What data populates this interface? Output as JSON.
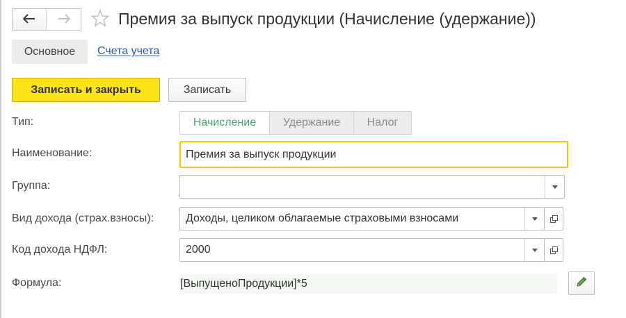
{
  "nav": {
    "back_icon": "arrow-left-icon",
    "forward_icon": "arrow-right-icon",
    "favorite_icon": "star-outline-icon"
  },
  "window": {
    "title": "Премия за выпуск продукции (Начисление (удержание))"
  },
  "tabs": [
    {
      "label": "Основное",
      "active": true
    },
    {
      "label": "Счета учета",
      "active": false
    }
  ],
  "toolbar": {
    "save_close_label": "Записать и закрыть",
    "save_label": "Записать"
  },
  "form": {
    "type": {
      "label": "Тип:",
      "options": [
        "Начисление",
        "Удержание",
        "Налог"
      ],
      "selected": "Начисление"
    },
    "name": {
      "label": "Наименование:",
      "value": "Премия за выпуск продукции"
    },
    "group": {
      "label": "Группа:",
      "value": ""
    },
    "income_type": {
      "label": "Вид дохода (страх.взносы):",
      "value": "Доходы, целиком облагаемые страховыми взносами"
    },
    "ndfl_code": {
      "label": "Код дохода НДФЛ:",
      "value": "2000"
    },
    "formula": {
      "label": "Формула:",
      "value": "[ВыпущеноПродукции]*5",
      "edit_icon": "pencil-icon"
    }
  },
  "colors": {
    "primary_button": "#fbe418",
    "focus_border": "#f2c31a",
    "link": "#2a5ab3",
    "selected_segment_text": "#4aa16b",
    "formula_background": "#f3f8f2"
  }
}
